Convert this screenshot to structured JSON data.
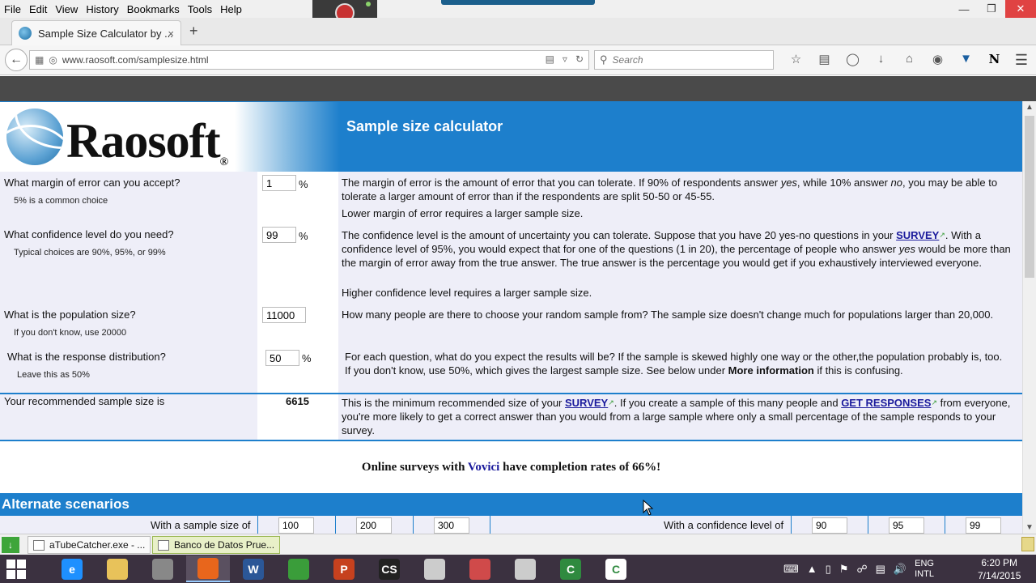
{
  "menubar": {
    "items": [
      "File",
      "Edit",
      "View",
      "History",
      "Bookmarks",
      "Tools",
      "Help"
    ]
  },
  "tab": {
    "title": "Sample Size Calculator by ...",
    "close": "×",
    "new": "+"
  },
  "nav": {
    "url": "www.raosoft.com/samplesize.html",
    "search_placeholder": "Search"
  },
  "page": {
    "logo_text": "Raosoft",
    "logo_reg": "®",
    "calc_title": "Sample size calculator",
    "questions": [
      {
        "label": "What margin of error can you accept?",
        "hint": "5% is a common choice",
        "value": "1",
        "unit": "%"
      },
      {
        "label": "What confidence level do you need?",
        "hint": "Typical choices are 90%, 95%, or 99%",
        "value": "99",
        "unit": "%"
      },
      {
        "label": "What is the population size?",
        "hint": "If you don't know, use 20000",
        "value": "11000",
        "unit": ""
      },
      {
        "label": "What is the response distribution?",
        "hint": "Leave this as 50%",
        "value": "50",
        "unit": "%"
      }
    ],
    "desc": {
      "margin_a": "The margin of error is the amount of error that you can tolerate. If 90% of respondents answer",
      "margin_yes": "yes",
      "margin_b": ", while 10% answer",
      "margin_no": "no",
      "margin_c": ", you may be able to tolerate a larger amount of error than if the respondents are split 50-50 or 45-55.",
      "margin_2": "Lower margin of error requires a larger sample size.",
      "conf_a": "The confidence level is the amount of uncertainty you can tolerate. Suppose that you have 20 yes-no questions in your",
      "conf_link": "SURVEY",
      "conf_b": ". With a confidence level of 95%, you would expect that for one of the questions (1 in 20), the percentage of people who answer",
      "conf_yes": "yes",
      "conf_c": "would be more than the margin of error away from the true answer. The true answer is the percentage you would get if you exhaustively interviewed everyone.",
      "conf_2": "Higher confidence level requires a larger sample size.",
      "pop": "How many people are there to choose your random sample from? The sample size doesn't change much for populations larger than 20,000.",
      "dist_a": "For each question, what do you expect the results will be? If the sample is skewed highly one way or the other,the population probably is, too. If you don't know, use 50%, which gives the largest sample size. See below under",
      "dist_bold": "More information",
      "dist_b": "if this is confusing.",
      "result_a": "This is the minimum recommended size of your",
      "result_link1": "SURVEY",
      "result_b": ". If you create a sample of this many people and",
      "result_link2": "GET RESPONSES",
      "result_c": "from everyone, you're more likely to get a correct answer than you would from a large sample where only a small percentage of the sample responds to your survey."
    },
    "result_label": "Your recommended sample size is",
    "result_value": "6615",
    "vovici_a": "Online surveys with",
    "vovici_brand": "Vovici",
    "vovici_b": "have completion rates of 66%!",
    "alt_title": "Alternate scenarios",
    "alt_sample_label": "With a sample size of",
    "alt_sample_values": [
      "100",
      "200",
      "300"
    ],
    "alt_conf_label": "With a confidence level of",
    "alt_conf_values": [
      "90",
      "95",
      "99"
    ]
  },
  "statusbar": {
    "items": [
      "aTubeCatcher.exe - ...",
      "Banco de Datos Prue..."
    ]
  },
  "taskbar": {
    "apps": [
      {
        "icon": "ie-icon",
        "color": "#1e90ff",
        "glyph": "e"
      },
      {
        "icon": "folder-icon",
        "color": "#e8c25a",
        "glyph": ""
      },
      {
        "icon": "calculator-icon",
        "color": "#888888",
        "glyph": ""
      },
      {
        "icon": "firefox-icon",
        "color": "#e8661c",
        "glyph": ""
      },
      {
        "icon": "word-icon",
        "color": "#2b5797",
        "glyph": "W"
      },
      {
        "icon": "chrome-icon",
        "color": "#3a9d3a",
        "glyph": ""
      },
      {
        "icon": "powerpoint-icon",
        "color": "#c6411e",
        "glyph": "P"
      },
      {
        "icon": "cs-icon",
        "color": "#222222",
        "glyph": "CS"
      },
      {
        "icon": "flame-icon",
        "color": "#cccccc",
        "glyph": ""
      },
      {
        "icon": "paint-icon",
        "color": "#d04a4a",
        "glyph": ""
      },
      {
        "icon": "flame2-icon",
        "color": "#cccccc",
        "glyph": ""
      },
      {
        "icon": "camtasia-icon",
        "color": "#2f8a3f",
        "glyph": "C"
      },
      {
        "icon": "camtasia2-icon",
        "color": "#ffffff",
        "glyph": "C"
      }
    ],
    "lang_top": "ENG",
    "lang_bottom": "INTL",
    "time": "6:20 PM",
    "date": "7/14/2015"
  }
}
